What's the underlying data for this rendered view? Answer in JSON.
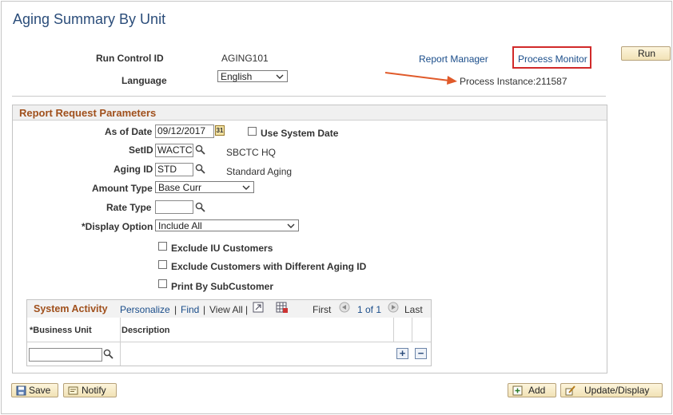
{
  "page": {
    "title": "Aging Summary By Unit",
    "run_control_id_label": "Run Control ID",
    "run_control_id_value": "AGING101",
    "language_label": "Language",
    "language_value": "English",
    "report_manager_link": "Report Manager",
    "process_monitor_link": "Process Monitor",
    "process_instance_text": "Process Instance:211587",
    "run_button": "Run"
  },
  "params": {
    "section_title": "Report Request Parameters",
    "as_of_date_label": "As of Date",
    "as_of_date_value": "09/12/2017",
    "calendar_glyph": "31",
    "use_system_date_label": "Use System Date",
    "setid_label": "SetID",
    "setid_value": "WACTC",
    "setid_desc": "SBCTC HQ",
    "aging_id_label": "Aging ID",
    "aging_id_value": "STD",
    "aging_id_desc": "Standard Aging",
    "amount_type_label": "Amount Type",
    "amount_type_value": "Base Curr",
    "rate_type_label": "Rate Type",
    "rate_type_value": "",
    "display_option_label": "*Display Option",
    "display_option_value": "Include All",
    "exclude_iu_label": "Exclude IU Customers",
    "exclude_diff_label": "Exclude Customers with Different Aging ID",
    "print_by_sub_label": "Print By SubCustomer"
  },
  "grid": {
    "title": "System Activity",
    "personalize": "Personalize",
    "find": "Find",
    "pipe": "|",
    "view_all": "View All",
    "first": "First",
    "range": "1 of 1",
    "last": "Last",
    "col_business_unit": "*Business Unit",
    "col_description": "Description",
    "add_row_glyph": "+",
    "delete_row_glyph": "−"
  },
  "toolbar": {
    "save": "Save",
    "notify": "Notify",
    "add": "Add",
    "update_display": "Update/Display"
  },
  "colors": {
    "title": "#2b4d7a",
    "link": "#1a4d8a",
    "section_title": "#a0501c",
    "highlight_box": "#d12a2a",
    "arrow": "#e05a2a"
  }
}
